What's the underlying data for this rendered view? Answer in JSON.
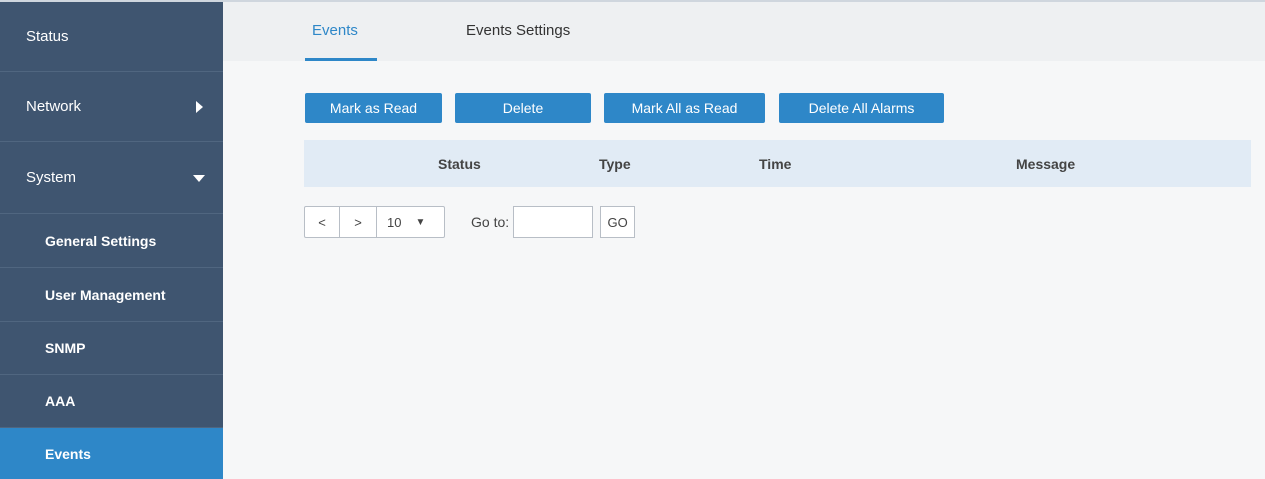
{
  "sidebar": {
    "items": [
      {
        "label": "Status"
      },
      {
        "label": "Network"
      },
      {
        "label": "System"
      },
      {
        "label": "General Settings"
      },
      {
        "label": "User Management"
      },
      {
        "label": "SNMP"
      },
      {
        "label": "AAA"
      },
      {
        "label": "Events"
      }
    ]
  },
  "tabs": [
    {
      "label": "Events"
    },
    {
      "label": "Events Settings"
    }
  ],
  "toolbar": {
    "mark_read": "Mark as Read",
    "delete": "Delete",
    "mark_all_read": "Mark All as Read",
    "delete_all": "Delete All Alarms"
  },
  "table": {
    "columns": [
      "Status",
      "Type",
      "Time",
      "Message"
    ]
  },
  "pager": {
    "prev": "<",
    "next": ">",
    "page_size": "10",
    "goto_label": "Go to:",
    "goto_value": "",
    "go_label": "GO"
  },
  "colors": {
    "sidebar_bg": "#3f5570",
    "accent": "#2e87c8"
  }
}
